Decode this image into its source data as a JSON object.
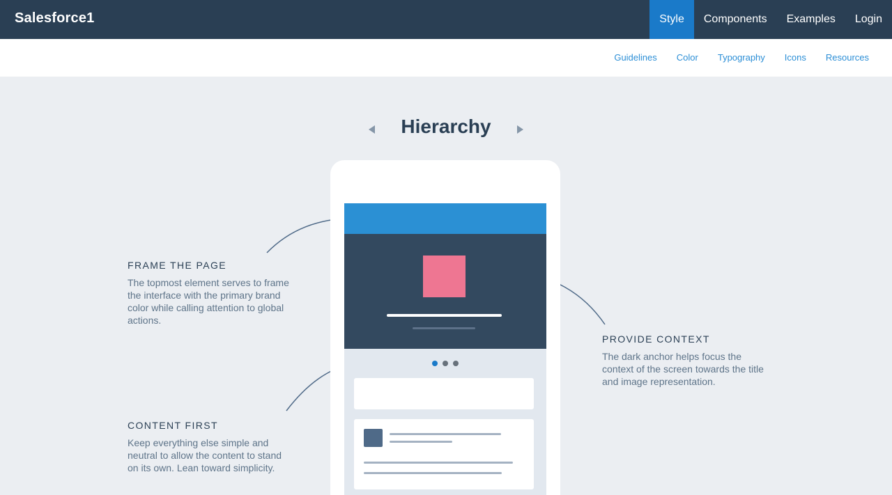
{
  "header": {
    "brand": "Salesforce1",
    "nav": [
      {
        "label": "Style",
        "active": true
      },
      {
        "label": "Components",
        "active": false
      },
      {
        "label": "Examples",
        "active": false
      },
      {
        "label": "Login",
        "active": false
      }
    ]
  },
  "subnav": [
    "Guidelines",
    "Color",
    "Typography",
    "Icons",
    "Resources"
  ],
  "main": {
    "title": "Hierarchy",
    "prev_icon": "triangle-left-icon",
    "next_icon": "triangle-right-icon",
    "callouts": {
      "frame": {
        "heading": "FRAME THE PAGE",
        "body": "The topmost element serves to frame the interface with the primary brand color while calling attention to global actions."
      },
      "context": {
        "heading": "PROVIDE CONTEXT",
        "body": "The dark anchor helps focus the context of the screen towards the title and image representation."
      },
      "content": {
        "heading": "CONTENT FIRST",
        "body": "Keep everything else simple and neutral to allow the content to stand on its own. Lean toward simplicity."
      }
    }
  },
  "colors": {
    "topbar": "#2a3f54",
    "active_tab": "#1a7ac9",
    "brand_blue": "#2b90d4",
    "anchor_dark": "#33495f",
    "accent_pink": "#ee7692",
    "page_bg": "#ebeef2"
  }
}
